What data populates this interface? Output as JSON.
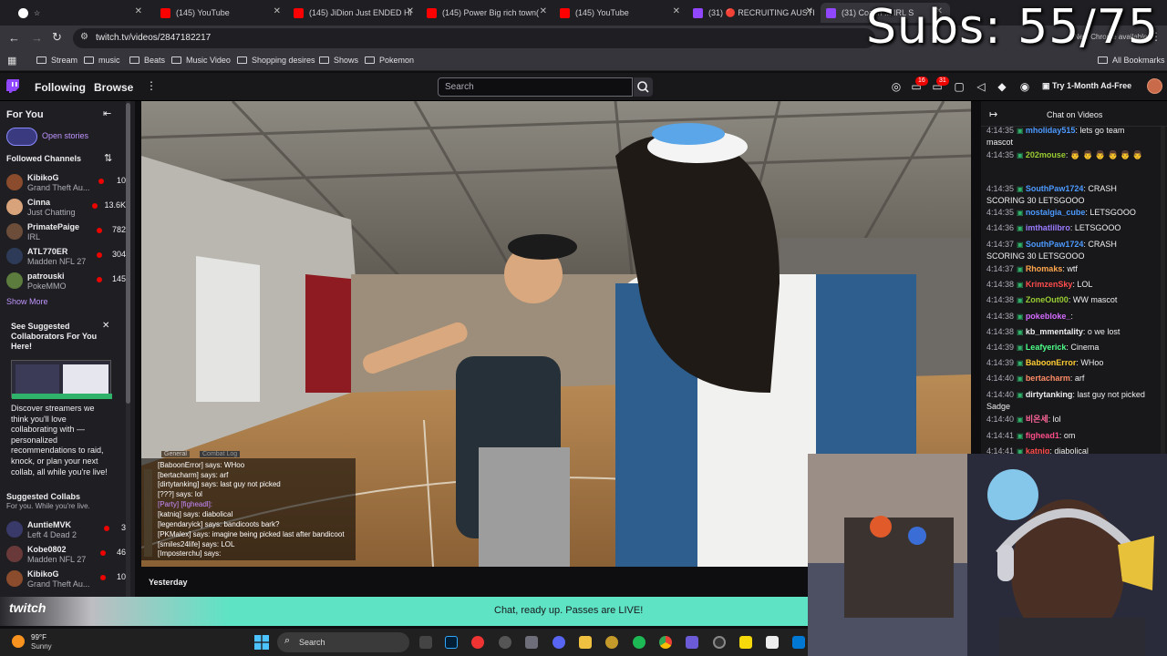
{
  "browser": {
    "tabs": [
      {
        "label": "",
        "favicon_color": "#ffffff"
      },
      {
        "label": "(145) YouTube",
        "favicon_color": "#ff0000"
      },
      {
        "label": "(145) JiDion Just ENDED Hi",
        "favicon_color": "#ff0000"
      },
      {
        "label": "(145) Power Big rich town(",
        "favicon_color": "#ff0000"
      },
      {
        "label": "(145) YouTube",
        "favicon_color": "#ff0000"
      },
      {
        "label": "(31) 🔴 RECRUITING AUSTI",
        "favicon_color": "#9146ff"
      },
      {
        "label": "(31) Coach ... IRL S",
        "favicon_color": "#9146ff"
      }
    ],
    "url": "twitch.tv/videos/2847182217",
    "new_chrome_available": "New Chrome available",
    "bookmarks": [
      "Stream",
      "music",
      "Beats",
      "Music Video",
      "Shopping desires",
      "Shows",
      "Pokemon"
    ],
    "all_bookmarks": "All Bookmarks"
  },
  "twitch_nav": {
    "following": "Following",
    "browse": "Browse",
    "search_placeholder": "Search",
    "notif_count_1": "16",
    "notif_count_2": "31",
    "ad_free": "Try 1-Month Ad-Free"
  },
  "sidebar": {
    "for_you": "For You",
    "open_stories": "Open stories",
    "followed_title": "Followed Channels",
    "followed": [
      {
        "name": "KibikoG",
        "game": "Grand Theft Au...",
        "viewers": "10",
        "color": "#8a4c2c"
      },
      {
        "name": "Cinna",
        "game": "Just Chatting",
        "viewers": "13.6K",
        "color": "#d8a37a"
      },
      {
        "name": "PrimatePaige",
        "game": "IRL",
        "viewers": "782",
        "color": "#6b4d3a"
      },
      {
        "name": "ATL770ER",
        "game": "Madden NFL 27",
        "viewers": "304",
        "color": "#2d3b58"
      },
      {
        "name": "patrouski",
        "game": "PokeMMO",
        "viewers": "145",
        "color": "#5b7c3d"
      }
    ],
    "show_more": "Show More",
    "suggest_title": "See Suggested Collaborators For You Here!",
    "suggest_body": "Discover streamers we think you'll love collaborating with — personalized recommendations to raid, knock, or plan your next collab, all while you're live!",
    "collabs_title": "Suggested Collabs",
    "collabs_sub": "For you. While you're live.",
    "collabs": [
      {
        "name": "AuntieMVK",
        "game": "Left 4 Dead 2",
        "viewers": "3",
        "color": "#3a3a6a"
      },
      {
        "name": "Kobe0802",
        "game": "Madden NFL 27",
        "viewers": "46",
        "color": "#6a3a3a"
      },
      {
        "name": "KibikoG",
        "game": "Grand Theft Au...",
        "viewers": "10",
        "color": "#8a4c2c"
      }
    ]
  },
  "overlay_chat": {
    "tabs": [
      "General",
      "Combat Log"
    ],
    "lines": [
      "[BaboonError] says: WHoo",
      "[bertacharm] says: arf",
      "[dirtytanking] says: last guy not picked",
      "[???] says: lol",
      "[Party] [figheadl]:",
      "[katniq] says: diabolical",
      "[legendaryick] says: bandicoots bark?",
      "[PKMalex] says: imagine being picked last after bandicoot",
      "[smiles24life] says: LOL",
      "[Imposterchu] says:"
    ]
  },
  "below_video": {
    "yesterday": "Yesterday"
  },
  "chat": {
    "title": "Chat on Videos",
    "messages": [
      {
        "ts": "4:14:35",
        "user": "mholiday515",
        "text": ": lets go team mascot",
        "color": "#4c9aff"
      },
      {
        "ts": "4:14:35",
        "user": "202mouse",
        "text": ": 👨 👨 👨 👨 👨 👨",
        "color": "#9acd32"
      },
      {
        "ts": "4:14:35",
        "user": "SouthPaw1724",
        "text": ": CRASH SCORING 30 LETSGOOO",
        "color": "#4c9aff"
      },
      {
        "ts": "4:14:35",
        "user": "nostalgia_cube",
        "text": ": LETSGOOO",
        "color": "#4c9aff"
      },
      {
        "ts": "4:14:36",
        "user": "imthatlilbro",
        "text": ": LETSGOOO",
        "color": "#9b7bff"
      },
      {
        "ts": "4:14:37",
        "user": "SouthPaw1724",
        "text": ": CRASH SCORING 30 LETSGOOO",
        "color": "#4c9aff"
      },
      {
        "ts": "4:14:37",
        "user": "Rhomaks",
        "text": ": wtf",
        "color": "#ffa64d"
      },
      {
        "ts": "4:14:38",
        "user": "KrimzenSky",
        "text": ": LOL",
        "color": "#ff4d4d"
      },
      {
        "ts": "4:14:38",
        "user": "ZoneOut00",
        "text": ": WW mascot",
        "color": "#9acd32"
      },
      {
        "ts": "4:14:38",
        "user": "pokebloke_",
        "text": ":",
        "color": "#d46bff"
      },
      {
        "ts": "4:14:38",
        "user": "kb_mmentality",
        "text": ": o we lost",
        "color": "#efeff1"
      },
      {
        "ts": "4:14:39",
        "user": "Leafyerick",
        "text": ": Cinema",
        "color": "#4dff88"
      },
      {
        "ts": "4:14:39",
        "user": "BaboonError",
        "text": ": WHoo",
        "color": "#ffcc33"
      },
      {
        "ts": "4:14:40",
        "user": "bertacharm",
        "text": ": arf",
        "color": "#ff8c66"
      },
      {
        "ts": "4:14:40",
        "user": "dirtytanking",
        "text": ": last guy not picked Sadge",
        "color": "#efeff1"
      },
      {
        "ts": "4:14:40",
        "user": "비온세",
        "text": ": lol",
        "color": "#ff6699"
      },
      {
        "ts": "4:14:41",
        "user": "fighead1",
        "text": ": om",
        "color": "#ff4d88"
      },
      {
        "ts": "4:14:41",
        "user": "katniq",
        "text": ": diabolical",
        "color": "#ff4d4d"
      }
    ]
  },
  "banner": {
    "text": "Chat, ready up. Passes are LIVE!",
    "logo": "twitch"
  },
  "taskbar": {
    "temp": "99°F",
    "weather": "Sunny",
    "search": "Search"
  },
  "overlay_subs": "Subs: 55/75",
  "colors": {
    "twitch_purple": "#9146ff",
    "live_red": "#eb0400",
    "banner_bg": "#5fe3c5"
  }
}
